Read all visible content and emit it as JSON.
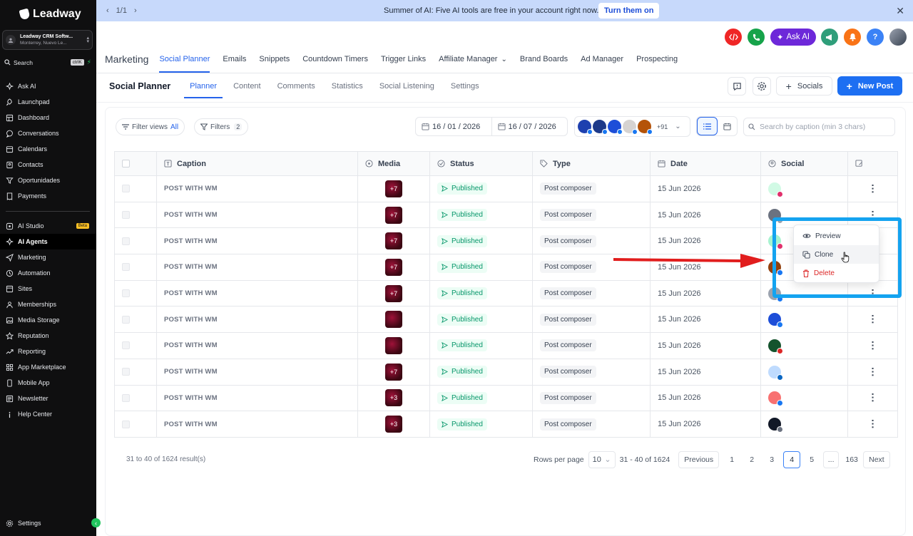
{
  "sidebar": {
    "brand": "Leadway",
    "location": {
      "name": "Leadway CRM Softw...",
      "city": "Monterrey, Nuevo Le..."
    },
    "search": {
      "label": "Search",
      "shortcut": "ctrlK"
    },
    "items": [
      {
        "label": "Ask AI",
        "icon": "sparkle-icon"
      },
      {
        "label": "Launchpad",
        "icon": "rocket-icon"
      },
      {
        "label": "Dashboard",
        "icon": "dashboard-icon"
      },
      {
        "label": "Conversations",
        "icon": "chat-icon"
      },
      {
        "label": "Calendars",
        "icon": "calendar-icon"
      },
      {
        "label": "Contacts",
        "icon": "contacts-icon"
      },
      {
        "label": "Oportunidades",
        "icon": "filter-icon"
      },
      {
        "label": "Payments",
        "icon": "receipt-icon"
      },
      {
        "label": "AI Studio",
        "icon": "ai-studio-icon",
        "badge": "Beta"
      },
      {
        "label": "AI Agents",
        "icon": "sparkle-icon"
      },
      {
        "label": "Marketing",
        "icon": "send-icon"
      },
      {
        "label": "Automation",
        "icon": "automation-icon"
      },
      {
        "label": "Sites",
        "icon": "globe-icon"
      },
      {
        "label": "Memberships",
        "icon": "membership-icon"
      },
      {
        "label": "Media Storage",
        "icon": "image-icon"
      },
      {
        "label": "Reputation",
        "icon": "star-icon"
      },
      {
        "label": "Reporting",
        "icon": "chart-icon"
      },
      {
        "label": "App Marketplace",
        "icon": "apps-icon"
      },
      {
        "label": "Mobile App",
        "icon": "mobile-icon"
      },
      {
        "label": "Newsletter",
        "icon": "newsletter-icon"
      },
      {
        "label": "Help Center",
        "icon": "info-icon"
      }
    ],
    "settings": "Settings"
  },
  "banner": {
    "page": "1/1",
    "text": "Summer of AI: Five AI tools are free in your account right now.",
    "button": "Turn them on"
  },
  "topbar": {
    "ask_ai": "Ask AI"
  },
  "main_tabs": {
    "title": "Marketing",
    "items": [
      "Social Planner",
      "Emails",
      "Snippets",
      "Countdown Timers",
      "Trigger Links",
      "Affiliate Manager",
      "Brand Boards",
      "Ad Manager",
      "Prospecting"
    ],
    "active": "Social Planner"
  },
  "sub_tabs": {
    "title": "Social Planner",
    "items": [
      "Planner",
      "Content",
      "Comments",
      "Statistics",
      "Social Listening",
      "Settings"
    ],
    "active": "Planner",
    "socials_button": "Socials",
    "new_post_button": "New Post"
  },
  "filters": {
    "filter_views": "Filter views",
    "filter_views_value": "All",
    "filters": "Filters",
    "filters_count": "2",
    "date_from": "16 / 01 / 2026",
    "date_to": "16 / 07 / 2026",
    "accounts_more": "+91",
    "search_placeholder": "Search by caption (min 3 chars)"
  },
  "table": {
    "columns": [
      "Caption",
      "Media",
      "Status",
      "Type",
      "Date",
      "Social"
    ],
    "rows": [
      {
        "caption": "POST WITH WM",
        "media": "+7",
        "status": "Published",
        "type": "Post composer",
        "date": "15 Jun 2026"
      },
      {
        "caption": "POST WITH WM",
        "media": "+7",
        "status": "Published",
        "type": "Post composer",
        "date": "15 Jun 2026"
      },
      {
        "caption": "POST WITH WM",
        "media": "+7",
        "status": "Published",
        "type": "Post composer",
        "date": "15 Jun 2026"
      },
      {
        "caption": "POST WITH WM",
        "media": "+7",
        "status": "Published",
        "type": "Post composer",
        "date": "15 Jun 2026"
      },
      {
        "caption": "POST WITH WM",
        "media": "+7",
        "status": "Published",
        "type": "Post composer",
        "date": "15 Jun 2026"
      },
      {
        "caption": "POST WITH WM",
        "media": "",
        "status": "Published",
        "type": "Post composer",
        "date": "15 Jun 2026"
      },
      {
        "caption": "POST WITH WM",
        "media": "",
        "status": "Published",
        "type": "Post composer",
        "date": "15 Jun 2026"
      },
      {
        "caption": "POST WITH WM",
        "media": "+7",
        "status": "Published",
        "type": "Post composer",
        "date": "15 Jun 2026"
      },
      {
        "caption": "POST WITH WM",
        "media": "+3",
        "status": "Published",
        "type": "Post composer",
        "date": "15 Jun 2026"
      },
      {
        "caption": "POST WITH WM",
        "media": "+3",
        "status": "Published",
        "type": "Post composer",
        "date": "15 Jun 2026"
      }
    ]
  },
  "context_menu": {
    "items": [
      "Preview",
      "Clone",
      "Delete"
    ]
  },
  "pagination": {
    "results": "31 to 40 of 1624 result(s)",
    "rows_per_page_label": "Rows per page",
    "rows_per_page": "10",
    "range": "31 - 40 of 1624",
    "previous": "Previous",
    "pages": [
      "1",
      "2",
      "3",
      "4",
      "5",
      "...",
      "163"
    ],
    "current": "4",
    "next": "Next"
  },
  "colors": {
    "accent": "#1d6ff2",
    "highlight": "#14a3f0",
    "arrow": "#e11d1d",
    "sidebar_bg": "#0f0f10"
  }
}
